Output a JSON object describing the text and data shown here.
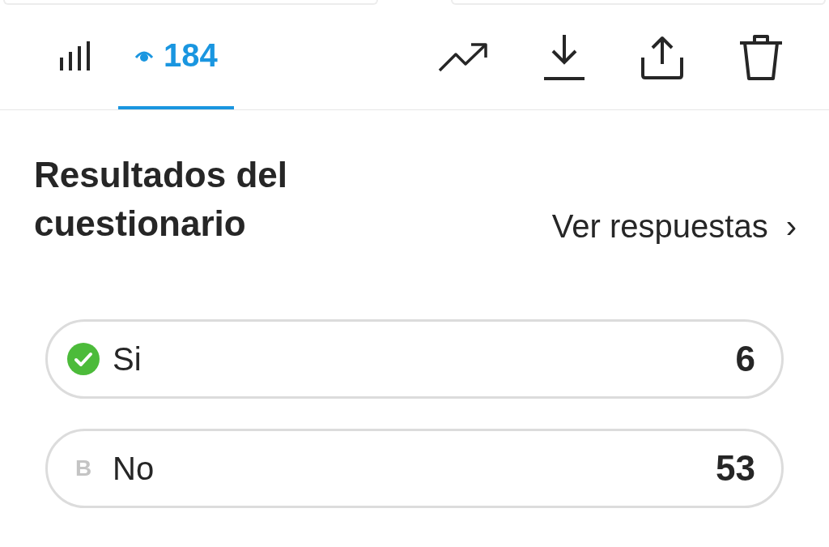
{
  "tabs": [
    {
      "kind": "stats",
      "selected": false
    },
    {
      "kind": "views",
      "label": "184",
      "selected": true
    }
  ],
  "actions": [
    {
      "kind": "trend"
    },
    {
      "kind": "download"
    },
    {
      "kind": "share"
    },
    {
      "kind": "delete"
    }
  ],
  "title": "Resultados del cuestionario",
  "link": "Ver respuestas",
  "link_chevron": "›",
  "options": [
    {
      "label": "Si",
      "count": "6",
      "correct": true
    },
    {
      "label": "No",
      "count": "53",
      "correct": false,
      "letter": "B"
    }
  ]
}
